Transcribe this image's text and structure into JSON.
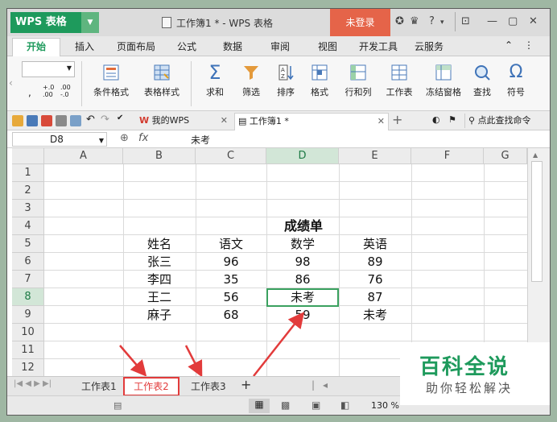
{
  "app": {
    "logo": "WPS 表格",
    "title": "工作簿1 * - WPS 表格",
    "login": "未登录",
    "help": "?"
  },
  "menu": [
    "开始",
    "插入",
    "页面布局",
    "公式",
    "数据",
    "审阅",
    "视图",
    "开发工具",
    "云服务"
  ],
  "ribbon": [
    {
      "label": "条件格式"
    },
    {
      "label": "表格样式"
    },
    {
      "label": "求和"
    },
    {
      "label": "筛选"
    },
    {
      "label": "排序"
    },
    {
      "label": "格式"
    },
    {
      "label": "行和列"
    },
    {
      "label": "工作表"
    },
    {
      "label": "冻结窗格"
    },
    {
      "label": "查找"
    },
    {
      "label": "符号"
    }
  ],
  "quickbar": {
    "tab_wps": "我的WPS",
    "tab_doc": "工作簿1 *",
    "search": "点此查找命令"
  },
  "formula": {
    "cell_ref": "D8",
    "fx": "fx",
    "value": "未考"
  },
  "columns": [
    "A",
    "B",
    "C",
    "D",
    "E",
    "F",
    "G"
  ],
  "rows": [
    "1",
    "2",
    "3",
    "4",
    "5",
    "6",
    "7",
    "8",
    "9",
    "10",
    "11",
    "12"
  ],
  "table": {
    "title": "成绩单",
    "header": [
      "姓名",
      "语文",
      "数学",
      "英语"
    ],
    "data": [
      [
        "张三",
        "96",
        "98",
        "89"
      ],
      [
        "李四",
        "35",
        "86",
        "76"
      ],
      [
        "王二",
        "56",
        "未考",
        "87"
      ],
      [
        "麻子",
        "68",
        "59",
        "未考"
      ]
    ]
  },
  "sheets": [
    "工作表1",
    "工作表2",
    "工作表3"
  ],
  "status": {
    "zoom": "130 %"
  },
  "watermark": {
    "title": "百科全说",
    "subtitle": "助你轻松解决"
  },
  "colors": {
    "accent": "#1e9a5c",
    "login": "#e56449",
    "annotation": "#e23b3b"
  }
}
